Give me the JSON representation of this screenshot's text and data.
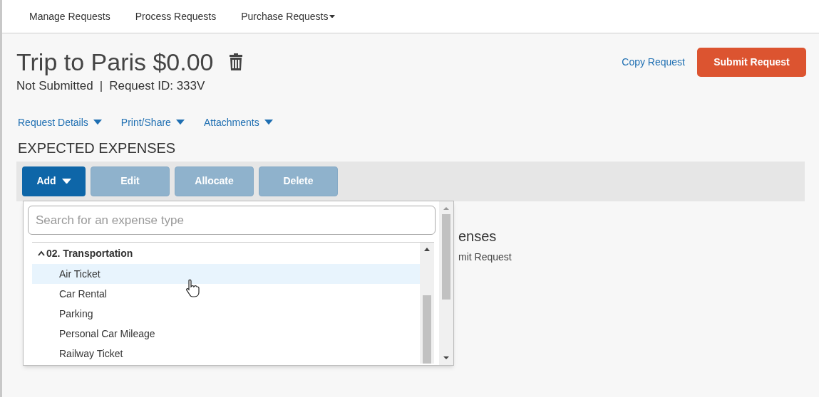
{
  "nav": [
    {
      "label": "Manage Requests",
      "has_menu": false
    },
    {
      "label": "Process Requests",
      "has_menu": false
    },
    {
      "label": "Purchase Requests",
      "has_menu": true
    }
  ],
  "header": {
    "title": "Trip to Paris $0.00",
    "status": "Not Submitted",
    "separator": "|",
    "request_id": "Request ID: 333V",
    "copy_link": "Copy Request",
    "submit_button": "Submit Request"
  },
  "menus": [
    "Request Details",
    "Print/Share",
    "Attachments"
  ],
  "section_title": "EXPECTED EXPENSES",
  "toolbar": [
    {
      "label": "Add",
      "disabled": false,
      "has_menu": true
    },
    {
      "label": "Edit",
      "disabled": true,
      "has_menu": false
    },
    {
      "label": "Allocate",
      "disabled": true,
      "has_menu": false
    },
    {
      "label": "Delete",
      "disabled": true,
      "has_menu": false
    }
  ],
  "behind": {
    "heading": "enses",
    "text": "mit Request"
  },
  "dropdown": {
    "search": {
      "placeholder": "Search for an expense type"
    },
    "group": {
      "label": "02. Transportation",
      "expanded": true,
      "children": [
        {
          "label": "Air Ticket",
          "selected": true
        },
        {
          "label": "Car Rental",
          "selected": false
        },
        {
          "label": "Parking",
          "selected": false
        },
        {
          "label": "Personal Car Mileage",
          "selected": false
        },
        {
          "label": "Railway Ticket",
          "selected": false
        }
      ]
    }
  }
}
